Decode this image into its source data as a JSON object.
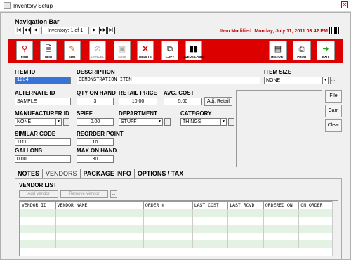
{
  "window": {
    "title": "Inventory Setup",
    "close_glyph": "✕"
  },
  "nav": {
    "header": "Navigation Bar",
    "record_text": "Inventory: 1 of 1",
    "modified_text": "Item Modified: Monday, July 11, 2011 03:42 PM",
    "buttons": [
      "|◀",
      "◀◀",
      "◀",
      "▶",
      "▶▶",
      "▶|"
    ]
  },
  "toolbar": {
    "find": "FIND",
    "new": "NEW",
    "edit": "EDIT",
    "cancel": "CANCEL",
    "save": "SAVE",
    "delete": "DELETE",
    "copy": "COPY",
    "queue_label": "QUEUE LABEL",
    "history": "HISTORY",
    "print": "PRINT",
    "exit": "EXIT"
  },
  "form": {
    "item_id_label": "ITEM ID",
    "item_id_value": "1234",
    "description_label": "DESCRIPTION",
    "description_value": "DEMONSTRATION ITEM",
    "item_size_label": "ITEM SIZE",
    "item_size_value": "NONE",
    "alt_number_label": "ALTERNATE ID",
    "alt_number_value": "SAMPLE",
    "qty_label": "QTY ON HAND",
    "qty_value": "3",
    "retail_label": "RETAIL PRICE",
    "retail_value": "10.00",
    "avg_cost_label": "AVG. COST",
    "avg_cost_value": "5.00",
    "adj_retail": "Adj. Retail",
    "mfr_label": "MANUFACTURER ID",
    "mfr_value": "NONE",
    "spiff_label": "SPIFF",
    "spiff_value": "0.00",
    "dept_label": "DEPARTMENT",
    "dept_value": "STUFF",
    "category_label": "CATEGORY",
    "category_value": "THINGS",
    "similar_label": "SIMILAR CODE",
    "similar_value": "1111",
    "reorder_label": "REORDER POINT",
    "reorder_value": "10",
    "gallons_label": "GALLONS",
    "gallons_value": "0.00",
    "max_label": "MAX ON HAND",
    "max_value": "30",
    "ellipsis": "..."
  },
  "side_buttons": {
    "file": "File",
    "cam": "Cam",
    "clear": "Clear"
  },
  "tabs": [
    "NOTES",
    "VENDORS",
    "PACKAGE INFO",
    "OPTIONS / TAX"
  ],
  "vendor_list": {
    "title": "VENDOR LIST",
    "add": "Add Vendor",
    "remove": "Remove Vendor",
    "more": "...",
    "columns": [
      "VENDOR ID",
      "VENDOR NAME",
      "ORDER #",
      "LAST COST",
      "LAST RCVD",
      "ORDERED ON",
      "ON ORDER"
    ]
  }
}
